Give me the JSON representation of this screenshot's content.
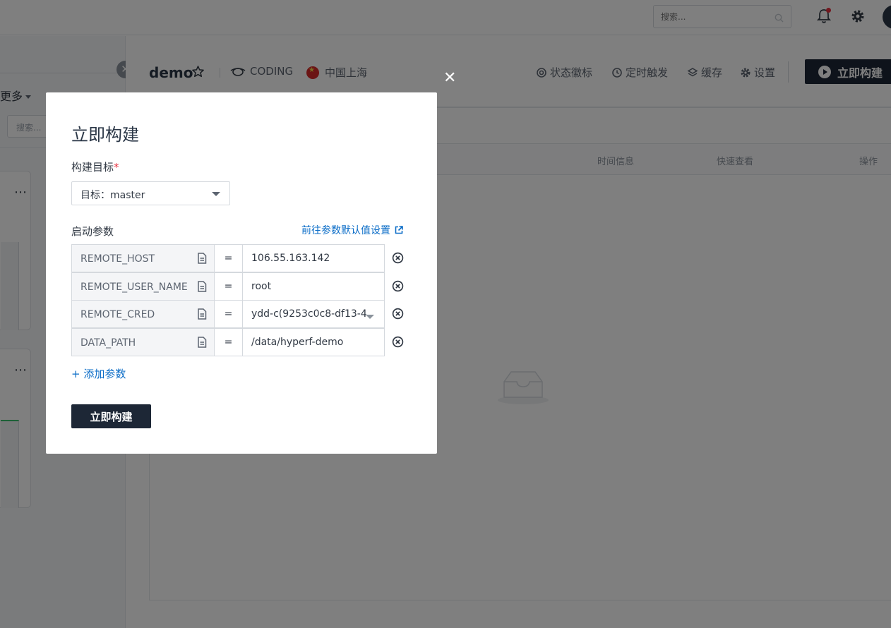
{
  "topbar": {
    "search_placeholder": "搜索..."
  },
  "left": {
    "more_label": "更多",
    "search_placeholder": "搜索..."
  },
  "header": {
    "title": "demo",
    "source": "CODING",
    "location": "中国上海",
    "actions": {
      "badge": "状态徽标",
      "trigger": "定时触发",
      "cache": "缓存",
      "settings": "设置",
      "build": "立即构建"
    }
  },
  "table": {
    "columns": [
      "时间信息",
      "快速查看",
      "操作"
    ]
  },
  "modal": {
    "title": "立即构建",
    "target_label": "构建目标",
    "target_required": "*",
    "target_value": "目标：master",
    "params_label": "启动参数",
    "params_link": "前往参数默认值设置",
    "params": [
      {
        "key": "REMOTE_HOST",
        "eq": "=",
        "value": "106.55.163.142"
      },
      {
        "key": "REMOTE_USER_NAME",
        "eq": "=",
        "value": "root"
      },
      {
        "key": "REMOTE_CRED",
        "eq": "=",
        "value": "ydd-c(9253c0c8-df13-4"
      },
      {
        "key": "DATA_PATH",
        "eq": "=",
        "value": "/data/hyperf-demo"
      }
    ],
    "add_param": "+ 添加参数",
    "submit": "立即构建"
  },
  "colors": {
    "primary_dark": "#1d2736",
    "link_blue": "#0a6cc7",
    "required_red": "#e7303f"
  }
}
